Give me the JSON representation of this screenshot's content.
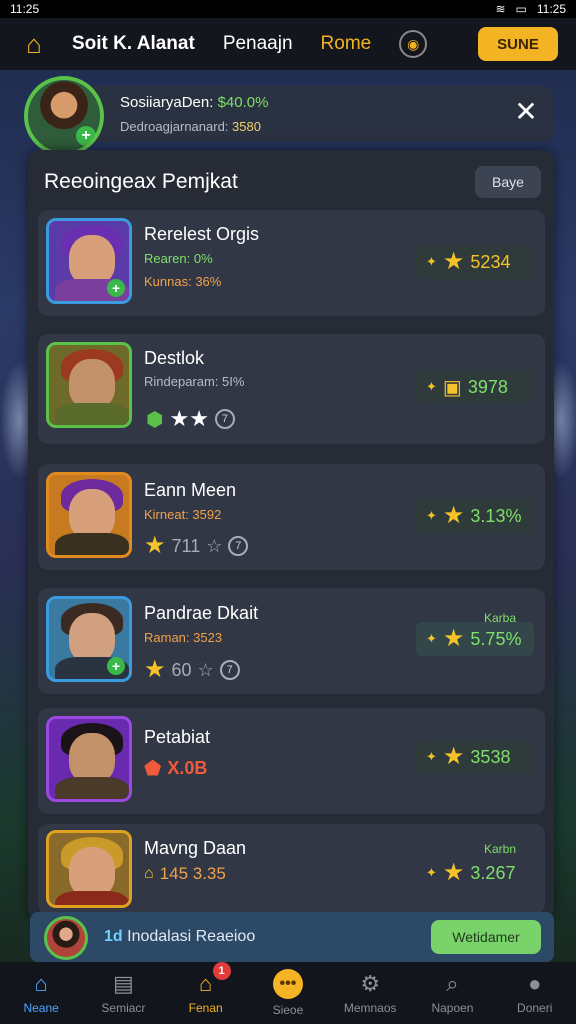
{
  "status": {
    "time": "11:25",
    "time_right": "11:25"
  },
  "topnav": {
    "title": "Soit K. Alanat",
    "link": "Penaajn",
    "active": "Rome",
    "store": "SUNE"
  },
  "profile": {
    "name": "SosiiaryaDen:",
    "name_value": "$40.0%",
    "sub": "Dedroagjarnanard:",
    "sub_value": "3580"
  },
  "panel": {
    "title": "Reeoingeax Pemjkat",
    "page_button": "Baye"
  },
  "cards": [
    {
      "name": "Rerelest Orgis",
      "stat1": "Rearen: 0%",
      "stat2": "Kunnas: 36%",
      "score": "5234",
      "color": "#f6c22a",
      "img_bg": "#5b3ba8",
      "hair": "#6a2fb0",
      "skin": "#d8a07a",
      "body": "#7a3e9c",
      "frame": "#3a9be0",
      "plus": true
    },
    {
      "name": "Destlok",
      "stat1": "Rindeparam: 5I%",
      "rating_text": "",
      "score": "3978",
      "color": "#7ee06a",
      "img_bg": "#6d6a2a",
      "hair": "#9c3a1f",
      "skin": "#c4926a",
      "body": "#5a6a2a",
      "frame": "#5ac24a",
      "plus": false
    },
    {
      "name": "Eann Meen",
      "stat1": "Kirneat: 3592",
      "rating_text": "711",
      "score": "3.13%",
      "color": "#7ee06a",
      "img_bg": "#c77a1f",
      "hair": "#6e2a9c",
      "skin": "#d8a07a",
      "body": "#3a3020",
      "frame": "#e08a20",
      "plus": false
    },
    {
      "name": "Pandrae Dkait",
      "stat1": "Raman: 3523",
      "rating_text": "60",
      "score": "5.75%",
      "tag": "Karba",
      "color": "#7ee06a",
      "img_bg": "#3a7aa0",
      "hair": "#3a2a22",
      "skin": "#d0a080",
      "body": "#2a3440",
      "frame": "#3a9be0",
      "plus": true
    },
    {
      "name": "Petabiat",
      "rating_text": "X.0B",
      "score": "3538",
      "color": "#7ee06a",
      "img_bg": "#6a2ab0",
      "hair": "#1a1418",
      "skin": "#c4926a",
      "body": "#4a3a2a",
      "frame": "#9a4ae0",
      "plus": false
    },
    {
      "name": "Mavng Daan",
      "stat1": "145 3.35",
      "score": "3.267",
      "tag": "Karbn",
      "color": "#7ee06a",
      "img_bg": "#8a6a2a",
      "hair": "#c99a2a",
      "skin": "#d8a07a",
      "body": "#8a2a1a",
      "frame": "#e0a020",
      "plus": false
    }
  ],
  "invite": {
    "highlight": "1d",
    "text": "Inodalasi Reaeioo",
    "button": "Wetidamer"
  },
  "tabs": [
    {
      "label": "Neane",
      "icon": "home-icon"
    },
    {
      "label": "Semiacr",
      "icon": "document-icon"
    },
    {
      "label": "Fenan",
      "icon": "shop-icon",
      "badge": "1"
    },
    {
      "label": "Sieoe",
      "icon": "chat-coin-icon"
    },
    {
      "label": "Memnaos",
      "icon": "settings-icon"
    },
    {
      "label": "Napoen",
      "icon": "search-icon"
    },
    {
      "label": "Doneri",
      "icon": "profile-icon"
    }
  ],
  "colors": {
    "accent": "#f4b323",
    "green": "#7ee06a",
    "blue": "#4ea6ff",
    "panel": "#262b35"
  }
}
